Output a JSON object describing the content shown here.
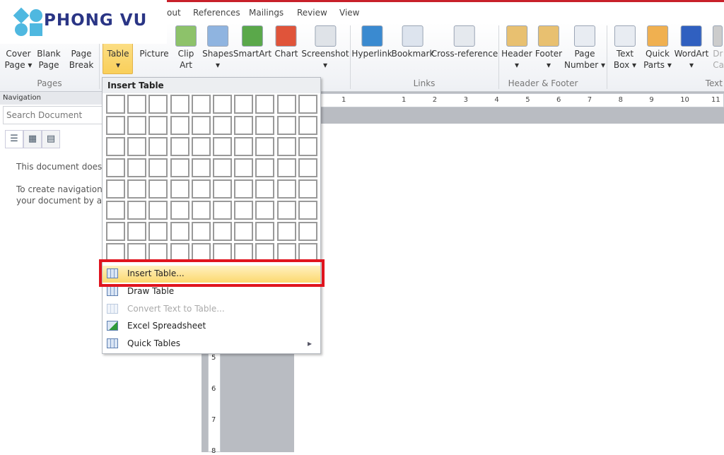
{
  "logo": {
    "text": "PHONG VU",
    "colors": [
      "#4fb8e0",
      "#2a3585"
    ]
  },
  "tabs": [
    "out",
    "References",
    "Mailings",
    "Review",
    "View"
  ],
  "ribbon": {
    "buttons": [
      {
        "l1": "Cover",
        "l2": "Page ▾",
        "icon": "cover-page-icon"
      },
      {
        "l1": "Blank",
        "l2": "Page",
        "icon": "blank-page-icon"
      },
      {
        "l1": "Page",
        "l2": "Break",
        "icon": "page-break-icon"
      },
      {
        "l1": "Table",
        "l2": "▾",
        "icon": "table-icon"
      },
      {
        "l1": "Picture",
        "l2": "",
        "icon": "picture-icon"
      },
      {
        "l1": "Clip",
        "l2": "Art",
        "icon": "clip-art-icon"
      },
      {
        "l1": "Shapes",
        "l2": "▾",
        "icon": "shapes-icon"
      },
      {
        "l1": "SmartArt",
        "l2": "",
        "icon": "smartart-icon"
      },
      {
        "l1": "Chart",
        "l2": "",
        "icon": "chart-icon"
      },
      {
        "l1": "Screenshot",
        "l2": "▾",
        "icon": "screenshot-icon"
      },
      {
        "l1": "Hyperlink",
        "l2": "",
        "icon": "hyperlink-icon"
      },
      {
        "l1": "Bookmark",
        "l2": "",
        "icon": "bookmark-icon"
      },
      {
        "l1": "Cross-reference",
        "l2": "",
        "icon": "cross-reference-icon"
      },
      {
        "l1": "Header",
        "l2": "▾",
        "icon": "header-icon"
      },
      {
        "l1": "Footer",
        "l2": "▾",
        "icon": "footer-icon"
      },
      {
        "l1": "Page",
        "l2": "Number ▾",
        "icon": "page-number-icon"
      },
      {
        "l1": "Text",
        "l2": "Box ▾",
        "icon": "text-box-icon"
      },
      {
        "l1": "Quick",
        "l2": "Parts ▾",
        "icon": "quick-parts-icon"
      },
      {
        "l1": "WordArt",
        "l2": "▾",
        "icon": "wordart-icon"
      },
      {
        "l1": "Dr",
        "l2": "Ca",
        "icon": "drop-cap-icon"
      }
    ],
    "groups": [
      "Pages",
      "Links",
      "Header & Footer",
      "Text"
    ]
  },
  "ruler": {
    "h": [
      "1",
      "1",
      "2",
      "3",
      "4",
      "5",
      "6",
      "7",
      "8",
      "9",
      "10",
      "11"
    ],
    "v": [
      "5",
      "6",
      "7",
      "8"
    ]
  },
  "navigation": {
    "title": "Navigation",
    "search_placeholder": "Search Document",
    "msg1": "This document does not contain headings.",
    "msg2a": "To create navigation tabs, create headings in",
    "msg2b": "your document by applying Heading styles."
  },
  "menu": {
    "header": "Insert Table",
    "grid": {
      "cols": 10,
      "rows": 8
    },
    "items": [
      {
        "label": "Insert Table...",
        "state": "highlighted"
      },
      {
        "label": "Draw Table",
        "state": "normal"
      },
      {
        "label": "Convert Text to Table...",
        "state": "disabled"
      },
      {
        "label": "Excel Spreadsheet",
        "state": "normal"
      },
      {
        "label": "Quick Tables",
        "state": "normal",
        "submenu": true
      }
    ]
  },
  "colors": {
    "highlight": "#fcd96f",
    "callout": "#e0141e"
  }
}
